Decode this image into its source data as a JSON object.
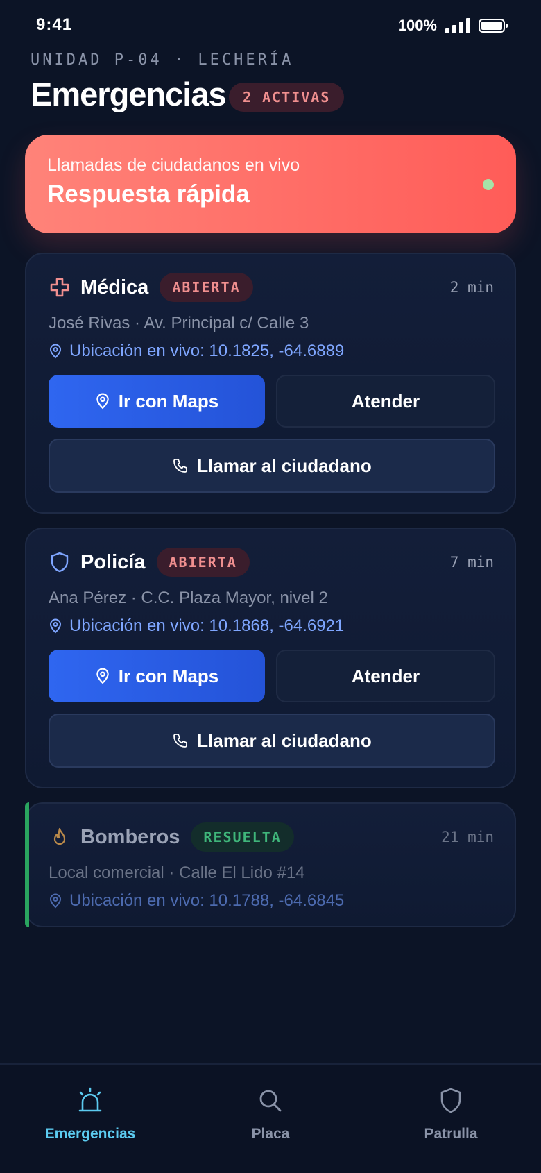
{
  "status_bar": {
    "time": "9:41",
    "battery": "100%"
  },
  "header": {
    "unit": "UNIDAD P-04 · LECHERÍA",
    "title": "Emergencias",
    "active_badge": "2 ACTIVAS"
  },
  "hero": {
    "subtitle": "Llamadas de ciudadanos en vivo",
    "title": "Respuesta rápida"
  },
  "emergencies": [
    {
      "type": "Médica",
      "icon": "medical-cross-icon",
      "status": "ABIERTA",
      "time": "2 min",
      "who": "José Rivas · Av. Principal c/ Calle 3",
      "location": "Ubicación en vivo: 10.1825, -64.6889",
      "maps_label": "Ir con Maps",
      "attend_label": "Atender",
      "call_label": "Llamar al ciudadano"
    },
    {
      "type": "Policía",
      "icon": "shield-icon",
      "status": "ABIERTA",
      "time": "7 min",
      "who": "Ana Pérez · C.C. Plaza Mayor, nivel 2",
      "location": "Ubicación en vivo: 10.1868, -64.6921",
      "maps_label": "Ir con Maps",
      "attend_label": "Atender",
      "call_label": "Llamar al ciudadano"
    },
    {
      "type": "Bomberos",
      "icon": "flame-icon",
      "status": "RESUELTA",
      "time": "21 min",
      "who": "Local comercial · Calle El Lido #14",
      "location": "Ubicación en vivo: 10.1788, -64.6845"
    }
  ],
  "tabs": [
    {
      "label": "Emergencias",
      "icon": "siren-icon",
      "active": true
    },
    {
      "label": "Placa",
      "icon": "search-icon",
      "active": false
    },
    {
      "label": "Patrulla",
      "icon": "shield-icon",
      "active": false
    }
  ],
  "colors": {
    "accent": "#2f66f0",
    "hero": "#ff6b64",
    "open": "#f08f8f",
    "resolved": "#3fb57a",
    "tab_active": "#5ccbf0"
  }
}
